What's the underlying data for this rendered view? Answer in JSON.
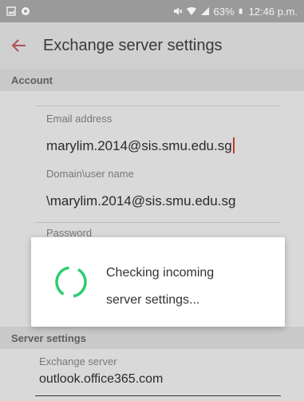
{
  "status_bar": {
    "battery_percent": "63%",
    "time": "12:46 p.m."
  },
  "app_bar": {
    "title": "Exchange server settings"
  },
  "account_section": {
    "header": "Account",
    "email_label": "Email address",
    "email_value": "marylim.2014@sis.smu.edu.sg",
    "domain_label": "Domain\\user name",
    "domain_value": "\\marylim.2014@sis.smu.edu.sg",
    "password_label": "Password"
  },
  "dialog": {
    "line1": "Checking incoming",
    "line2": "server settings..."
  },
  "server_section": {
    "header": "Server settings",
    "exchange_label": "Exchange server",
    "exchange_value": "outlook.office365.com"
  },
  "colors": {
    "accent": "#c0392b",
    "spinner": "#2ecc71"
  }
}
